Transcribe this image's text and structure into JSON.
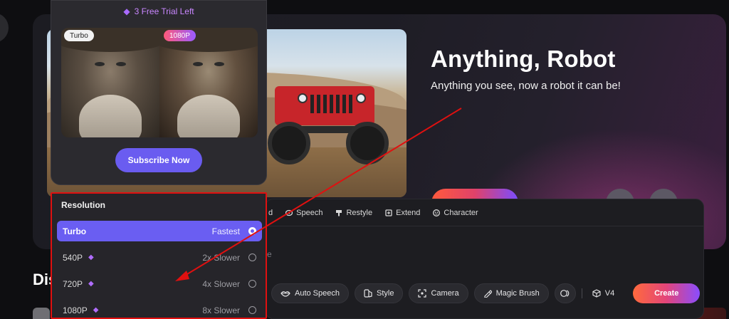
{
  "hero": {
    "title": "Anything, Robot",
    "subtitle": "Anything you see, now a robot it can be!"
  },
  "section": {
    "title": "Dis"
  },
  "popup": {
    "trial_text": "3 Free Trial Left",
    "tag_left": "Turbo",
    "tag_right": "1080P",
    "subscribe_label": "Subscribe Now"
  },
  "resolution": {
    "title": "Resolution",
    "options": [
      {
        "name": "Turbo",
        "speed": "Fastest",
        "selected": true,
        "premium": false
      },
      {
        "name": "540P",
        "speed": "2x Slower",
        "selected": false,
        "premium": true
      },
      {
        "name": "720P",
        "speed": "4x Slower",
        "selected": false,
        "premium": true
      },
      {
        "name": "1080P",
        "speed": "8x Slower",
        "selected": false,
        "premium": true
      }
    ]
  },
  "toolbar": {
    "tabs": [
      {
        "label": "d",
        "icon": "partial-tab-icon"
      },
      {
        "label": "Speech",
        "icon": "speech-icon"
      },
      {
        "label": "Restyle",
        "icon": "restyle-icon"
      },
      {
        "label": "Extend",
        "icon": "extend-icon"
      },
      {
        "label": "Character",
        "icon": "character-icon"
      }
    ],
    "prompt_fragment": "e",
    "tools": {
      "auto_speech": "Auto Speech",
      "style": "Style",
      "camera": "Camera",
      "magic_brush": "Magic Brush"
    },
    "version": "V4",
    "create_label": "Create"
  },
  "colors": {
    "accent": "#6a5ef2",
    "highlight_border": "#e01010",
    "create_gradient_start": "#ff6a3d",
    "create_gradient_end": "#8a4dff"
  }
}
